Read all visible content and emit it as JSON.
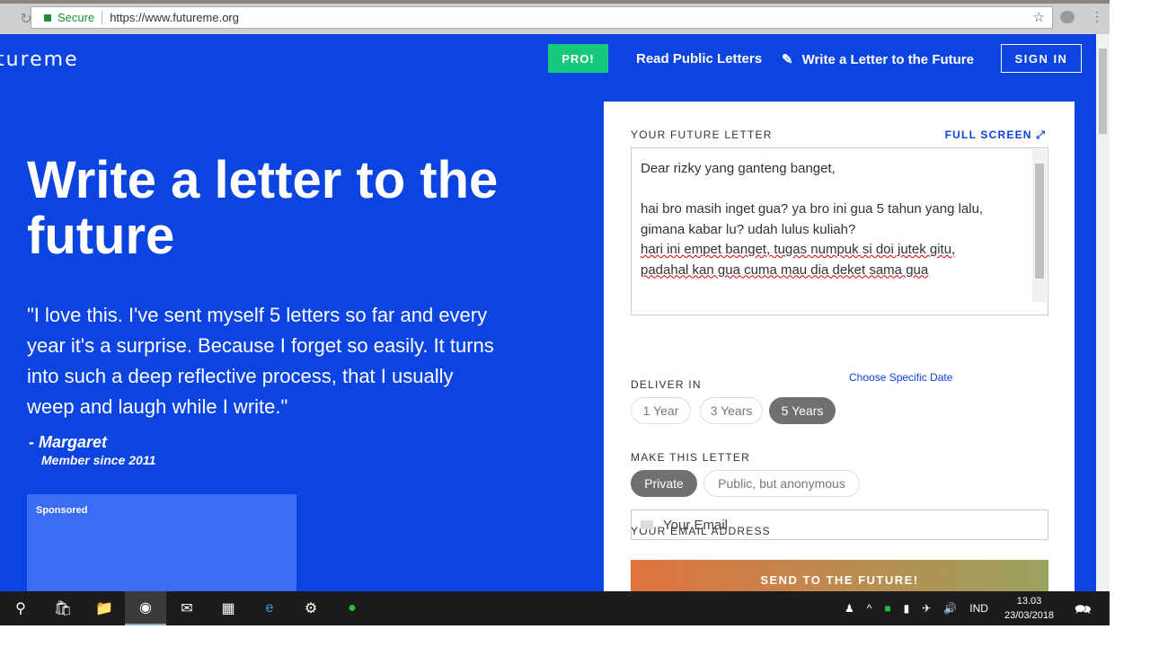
{
  "browser": {
    "secure_label": "Secure",
    "url": "https://www.futureme.org"
  },
  "site": {
    "logo": "tureme",
    "pro": "PRO!",
    "read_public": "Read Public Letters",
    "write_letter": "Write a Letter to the Future",
    "sign_in": "SIGN IN"
  },
  "hero": {
    "title": "Write a letter to the future",
    "quote": "\"I love this. I've sent myself 5 letters so far and every year it's a surprise. Because I forget so easily. It turns into such a deep reflective process, that I usually weep and laugh while I write.\"",
    "author": "- Margaret",
    "member": "Member since 2011",
    "sponsored": "Sponsored"
  },
  "form": {
    "letter_label": "YOUR FUTURE LETTER",
    "full_screen": "FULL SCREEN",
    "letter_lines": [
      "Dear rizky yang ganteng banget,",
      "",
      "hai bro masih inget gua? ya bro ini gua 5 tahun yang lalu,",
      "gimana kabar lu? udah lulus kuliah?",
      "hari ini empet banget, tugas numpuk si doi jutek gitu,",
      "padahal kan gua cuma mau dia deket sama gua"
    ],
    "deliver_label": "DELIVER IN",
    "deliver_options": [
      "1 Year",
      "3 Years",
      "5 Years"
    ],
    "deliver_selected": "5 Years",
    "choose_date": "Choose Specific Date",
    "privacy_label": "MAKE THIS LETTER",
    "privacy_options": [
      "Private",
      "Public, but anonymous"
    ],
    "privacy_selected": "Private",
    "email_label": "YOUR EMAIL ADDRESS",
    "email_placeholder": "Your Email",
    "send": "SEND TO THE FUTURE!"
  },
  "taskbar": {
    "lang": "IND",
    "time": "13.03",
    "date": "23/03/2018"
  },
  "colors": {
    "brand_blue": "#0b44e0",
    "pro_green": "#14c97b"
  }
}
